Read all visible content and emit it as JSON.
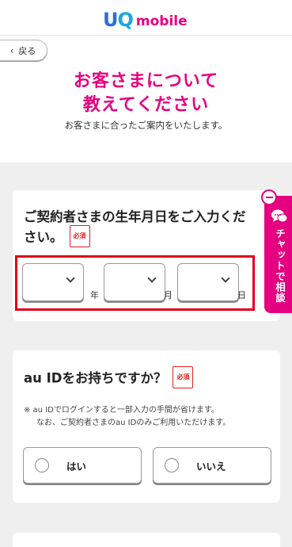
{
  "header": {
    "logo_uq_u": "U",
    "logo_uq_q": "Q",
    "logo_mobile": "mobile",
    "back_label": "戻る",
    "title_line1": "お客さまについて",
    "title_line2": "教えてください",
    "subtitle": "お客さまに合ったご案内をいたします。"
  },
  "birthdate": {
    "question_line1": "ご契約者さまの生年月日をご入力くだ",
    "question_line2": "さい。",
    "required_badge": "必須",
    "year_value": "",
    "month_value": "",
    "day_value": "",
    "year_unit": "年",
    "month_unit": "月",
    "day_unit": "日"
  },
  "auid": {
    "question": "au IDをお持ちですか？",
    "required_badge": "必須",
    "note_line1": "※ au IDでログインすると一部入力の手間が省けます。",
    "note_line2": "なお、ご契約者さまのau IDのみご利用いただけます。",
    "option_yes": "はい",
    "option_no": "いいえ"
  },
  "chat": {
    "label": "チャットで相談"
  },
  "colors": {
    "brand_pink": "#e4007f",
    "highlight_red": "#e0001a",
    "logo_blue": "#2d6fd8"
  }
}
